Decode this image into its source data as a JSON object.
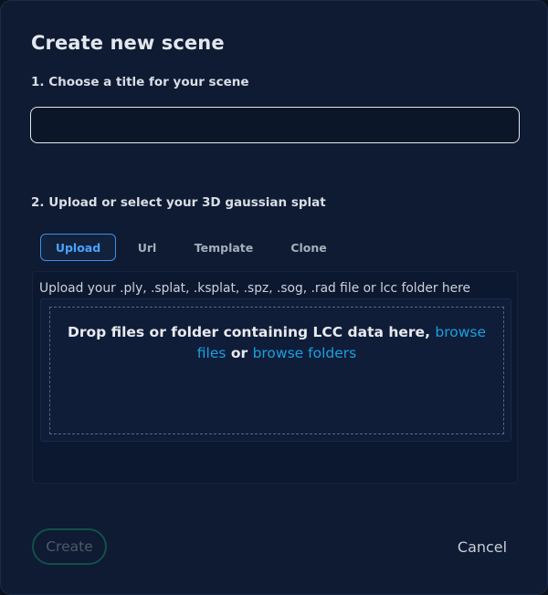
{
  "dialog": {
    "title": "Create new scene",
    "step1_label": "1. Choose a title for your scene",
    "title_input": {
      "value": "",
      "placeholder": ""
    },
    "step2_label": "2. Upload or select your 3D gaussian splat",
    "tabs": [
      {
        "label": "Upload",
        "active": true
      },
      {
        "label": "Url",
        "active": false
      },
      {
        "label": "Template",
        "active": false
      },
      {
        "label": "Clone",
        "active": false
      }
    ],
    "upload_hint": "Upload your .ply, .splat, .ksplat, .spz, .sog, .rad file or lcc folder here",
    "dropzone": {
      "text_prefix": "Drop files or folder containing LCC data here, ",
      "browse_files_label": "browse files",
      "text_or": " or ",
      "browse_folders_label": "browse folders"
    },
    "create_label": "Create",
    "cancel_label": "Cancel"
  },
  "colors": {
    "background": "#0e1b33",
    "accent_link": "#1aa0e0",
    "tab_active": "#4aa3ff",
    "create_border": "#134f4a"
  }
}
